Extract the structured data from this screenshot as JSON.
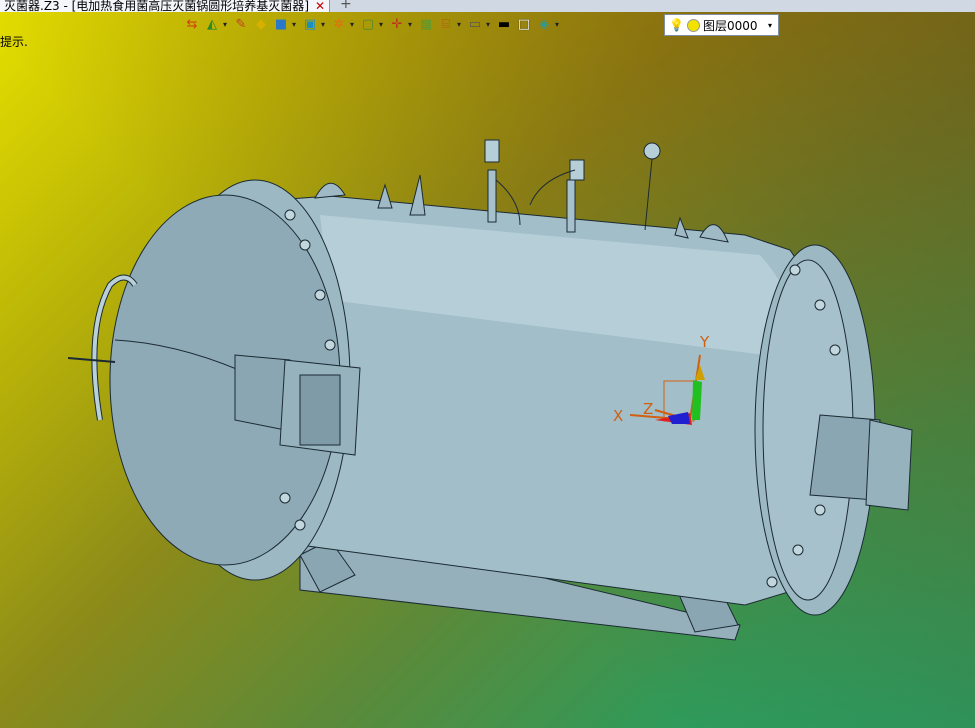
{
  "tab": {
    "title": "灭菌器.Z3 - [电加热食用菌高压灭菌锅圆形培养基灭菌器]",
    "close": "✕",
    "new": "+"
  },
  "hint": "提示.",
  "toolbar": {
    "icons": [
      "import-icon",
      "layer-tool-icon",
      "pencil-icon",
      "solid-box-icon",
      "shaded-cube-icon",
      "view-cube-icon",
      "render-icon",
      "frame-icon",
      "axis-icon",
      "image-icon",
      "dimension-icon",
      "monitor-icon",
      "line-color-icon",
      "fill-color-icon",
      "layer-stack-icon"
    ]
  },
  "layer": {
    "name": "图层0000"
  },
  "axes": {
    "x": "X",
    "y": "Y",
    "z": "Z"
  },
  "colors": {
    "model": "#a6c1cc",
    "outline": "#1b2a33"
  }
}
